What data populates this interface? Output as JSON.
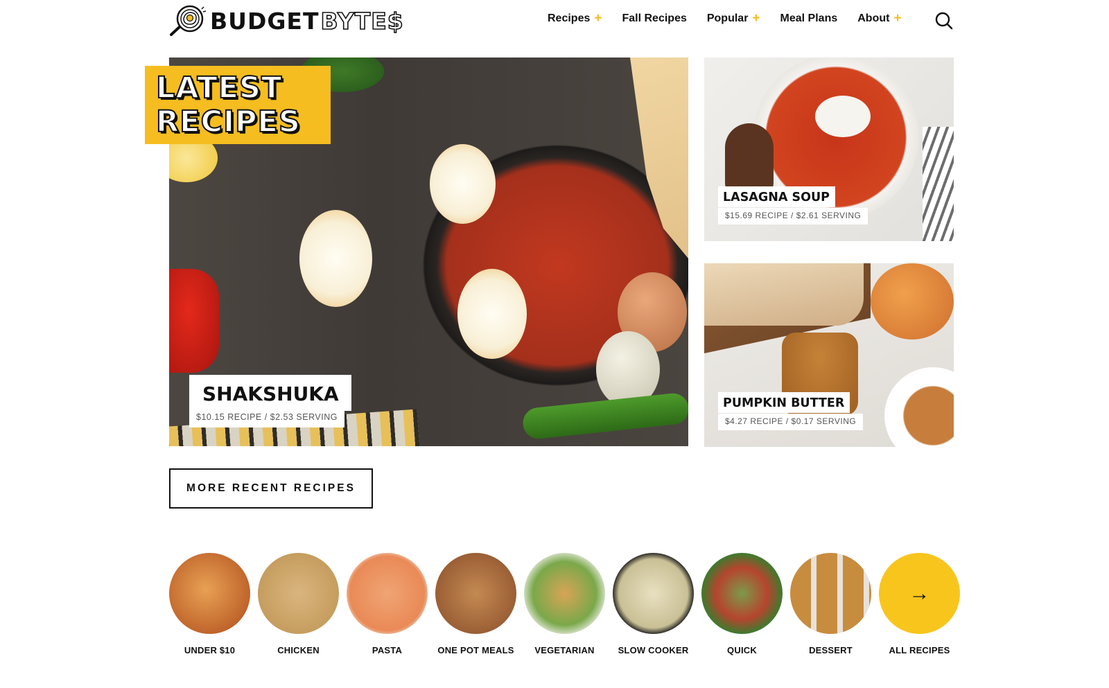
{
  "site": {
    "logo_bold": "BUDGET",
    "logo_outline": "BYTE$"
  },
  "nav": {
    "items": [
      {
        "label": "Recipes",
        "has_submenu": true
      },
      {
        "label": "Fall Recipes",
        "has_submenu": false
      },
      {
        "label": "Popular",
        "has_submenu": true
      },
      {
        "label": "Meal Plans",
        "has_submenu": false
      },
      {
        "label": "About",
        "has_submenu": true
      }
    ],
    "submenu_glyph": "+",
    "search_icon": "search-icon"
  },
  "hero": {
    "badge_line1": "LATEST",
    "badge_line2": "RECIPES",
    "main": {
      "title": "SHAKSHUKA",
      "price": "$10.15 RECIPE / $2.53 SERVING"
    },
    "side": [
      {
        "title": "LASAGNA SOUP",
        "price": "$15.69 RECIPE / $2.61 SERVING"
      },
      {
        "title": "PUMPKIN BUTTER",
        "price": "$4.27 RECIPE / $0.17 SERVING"
      }
    ]
  },
  "more_button": "MORE RECENT RECIPES",
  "categories": [
    {
      "label": "UNDER $10"
    },
    {
      "label": "CHICKEN"
    },
    {
      "label": "PASTA"
    },
    {
      "label": "ONE POT MEALS"
    },
    {
      "label": "VEGETARIAN"
    },
    {
      "label": "SLOW COOKER"
    },
    {
      "label": "QUICK"
    },
    {
      "label": "DESSERT"
    },
    {
      "label": "ALL RECIPES",
      "icon": "→"
    }
  ],
  "colors": {
    "accent_yellow": "#f5bd1f",
    "text_dark": "#111111"
  }
}
